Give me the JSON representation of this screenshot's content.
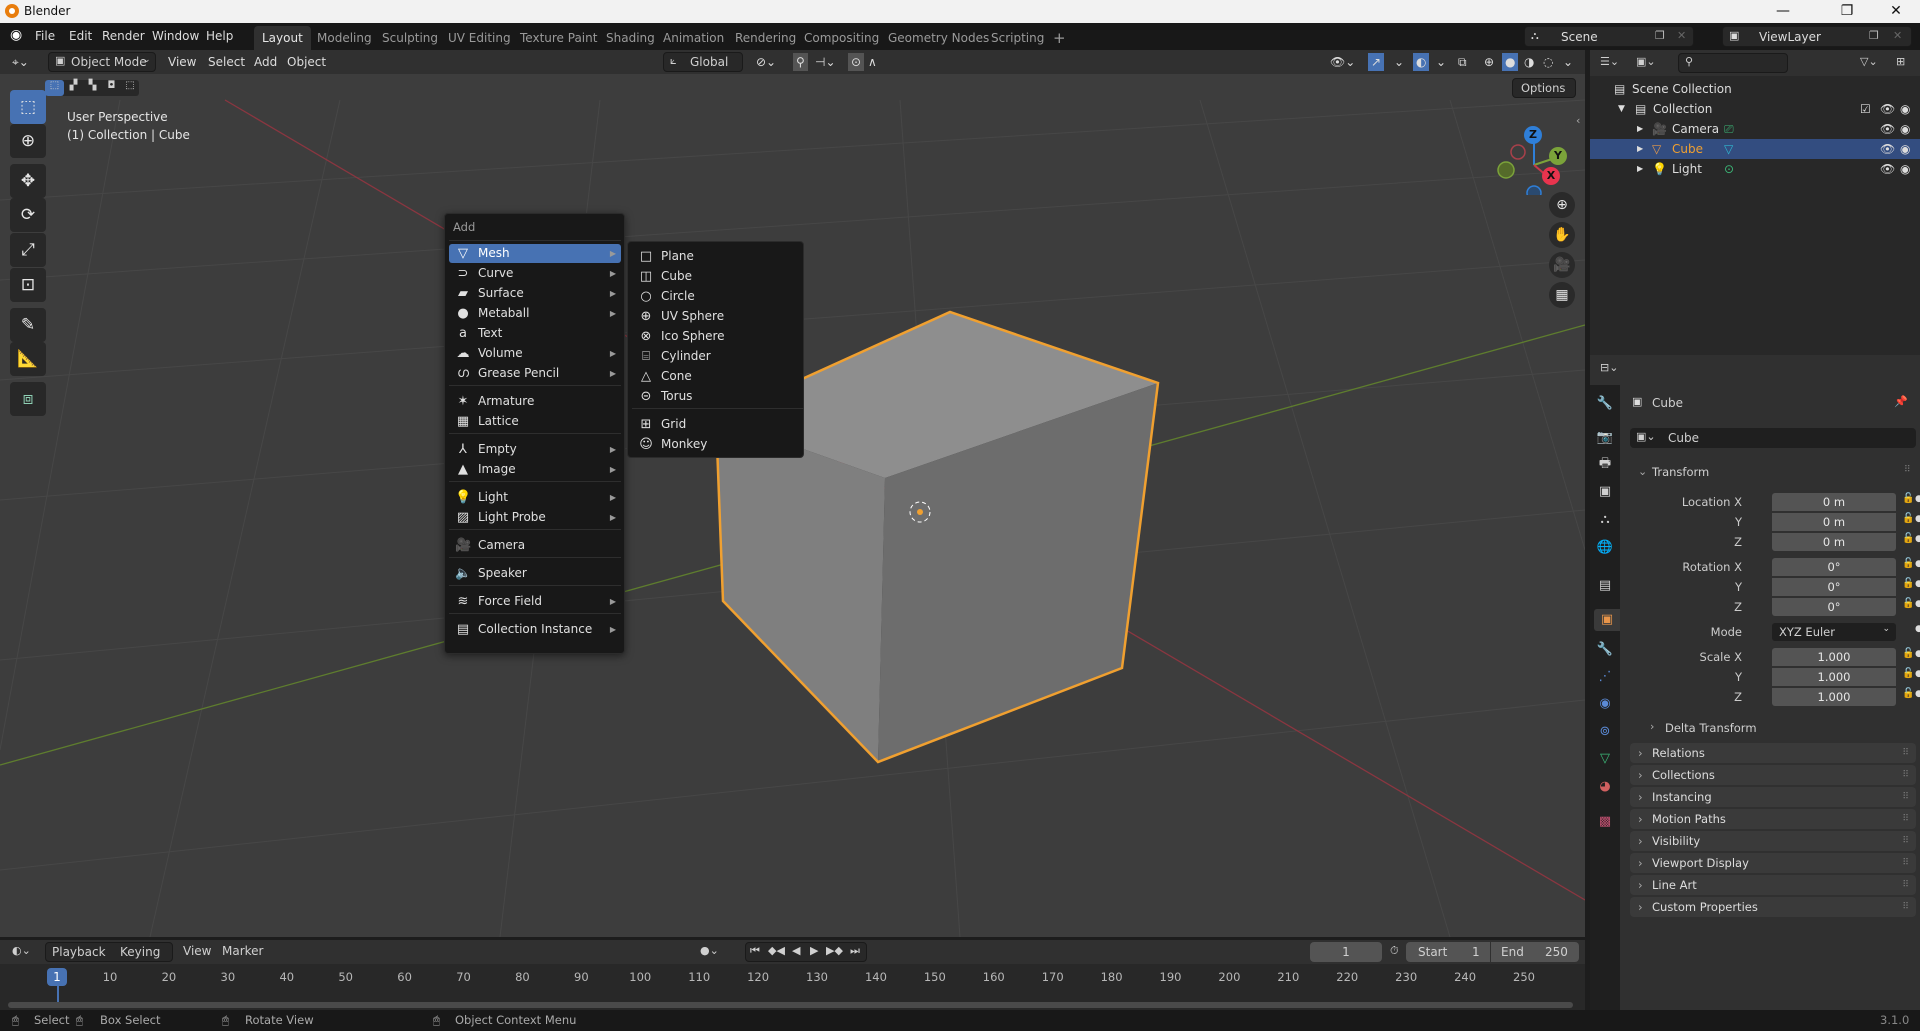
{
  "window": {
    "title": "Blender",
    "minimize": "—",
    "maximize": "❐",
    "close": "✕"
  },
  "menubar": {
    "items": [
      "File",
      "Edit",
      "Render",
      "Window",
      "Help"
    ],
    "workspaces": [
      "Layout",
      "Modeling",
      "Sculpting",
      "UV Editing",
      "Texture Paint",
      "Shading",
      "Animation",
      "Rendering",
      "Compositing",
      "Geometry Nodes",
      "Scripting"
    ],
    "active_workspace": "Layout",
    "add_workspace": "+",
    "scene": "Scene",
    "view_layer": "ViewLayer"
  },
  "viewport_header": {
    "mode": "Object Mode",
    "menus": [
      "View",
      "Select",
      "Add",
      "Object"
    ],
    "orientation": "Global",
    "options": "Options"
  },
  "viewport": {
    "view_name": "User Perspective",
    "context": "(1) Collection | Cube",
    "gizmo_axes": [
      "Z",
      "Y",
      "X"
    ],
    "colors": {
      "x_axis": "#c8384a",
      "y_axis": "#7ba33a",
      "z_axis": "#2f7fd8",
      "selection": "#f0a030",
      "accent": "#4772b3"
    }
  },
  "add_menu": {
    "title": "Add",
    "items": [
      {
        "label": "Mesh",
        "icon": "mesh-icon",
        "glyph": "▽",
        "submenu": true,
        "highlighted": true
      },
      {
        "label": "Curve",
        "icon": "curve-icon",
        "glyph": "⊃",
        "submenu": true
      },
      {
        "label": "Surface",
        "icon": "surface-icon",
        "glyph": "▰",
        "submenu": true
      },
      {
        "label": "Metaball",
        "icon": "metaball-icon",
        "glyph": "●",
        "submenu": true
      },
      {
        "label": "Text",
        "icon": "text-icon",
        "glyph": "a",
        "submenu": false
      },
      {
        "label": "Volume",
        "icon": "volume-icon",
        "glyph": "☁",
        "submenu": true
      },
      {
        "label": "Grease Pencil",
        "icon": "grease-pencil-icon",
        "glyph": "ഗ",
        "submenu": true
      },
      {
        "label": "Armature",
        "icon": "armature-icon",
        "glyph": "✶",
        "submenu": false
      },
      {
        "label": "Lattice",
        "icon": "lattice-icon",
        "glyph": "▦",
        "submenu": false
      },
      {
        "label": "Empty",
        "icon": "empty-icon",
        "glyph": "⅄",
        "submenu": true
      },
      {
        "label": "Image",
        "icon": "image-icon",
        "glyph": "▲",
        "submenu": true
      },
      {
        "label": "Light",
        "icon": "light-icon",
        "glyph": "💡",
        "submenu": true
      },
      {
        "label": "Light Probe",
        "icon": "light-probe-icon",
        "glyph": "▨",
        "submenu": true
      },
      {
        "label": "Camera",
        "icon": "camera-icon",
        "glyph": "🎥",
        "submenu": false
      },
      {
        "label": "Speaker",
        "icon": "speaker-icon",
        "glyph": "🔈",
        "submenu": false
      },
      {
        "label": "Force Field",
        "icon": "force-field-icon",
        "glyph": "≋",
        "submenu": true
      },
      {
        "label": "Collection Instance",
        "icon": "collection-instance-icon",
        "glyph": "▤",
        "submenu": true
      }
    ]
  },
  "mesh_submenu": {
    "items": [
      {
        "label": "Plane",
        "icon": "plane-icon",
        "glyph": "□"
      },
      {
        "label": "Cube",
        "icon": "cube-icon",
        "glyph": "◫"
      },
      {
        "label": "Circle",
        "icon": "circle-icon",
        "glyph": "○"
      },
      {
        "label": "UV Sphere",
        "icon": "uv-sphere-icon",
        "glyph": "⊕"
      },
      {
        "label": "Ico Sphere",
        "icon": "ico-sphere-icon",
        "glyph": "⊗"
      },
      {
        "label": "Cylinder",
        "icon": "cylinder-icon",
        "glyph": "⌸"
      },
      {
        "label": "Cone",
        "icon": "cone-icon",
        "glyph": "△"
      },
      {
        "label": "Torus",
        "icon": "torus-icon",
        "glyph": "⊝"
      },
      {
        "label": "Grid",
        "icon": "grid-icon",
        "glyph": "⊞"
      },
      {
        "label": "Monkey",
        "icon": "monkey-icon",
        "glyph": "☺"
      }
    ]
  },
  "outliner": {
    "root": "Scene Collection",
    "collection": "Collection",
    "objects": [
      {
        "name": "Camera",
        "selected": false,
        "type_glyph": "🎥",
        "data_glyph": "⎚"
      },
      {
        "name": "Cube",
        "selected": true,
        "type_glyph": "▽",
        "data_glyph": "▽"
      },
      {
        "name": "Light",
        "selected": false,
        "type_glyph": "💡",
        "data_glyph": "⊙"
      }
    ]
  },
  "properties": {
    "object_name": "Cube",
    "data_name": "Cube",
    "transform_title": "Transform",
    "location": {
      "label": "Location X",
      "x": "0 m",
      "y": "0 m",
      "z": "0 m"
    },
    "rotation": {
      "label": "Rotation X",
      "x": "0°",
      "y": "0°",
      "z": "0°"
    },
    "mode_label": "Mode",
    "mode": "XYZ Euler",
    "scale": {
      "label": "Scale X",
      "x": "1.000",
      "y": "1.000",
      "z": "1.000"
    },
    "axis_y": "Y",
    "axis_z": "Z",
    "delta_transform": "Delta Transform",
    "panels": [
      "Relations",
      "Collections",
      "Instancing",
      "Motion Paths",
      "Visibility",
      "Viewport Display",
      "Line Art",
      "Custom Properties"
    ]
  },
  "timeline": {
    "menus": [
      "Playback",
      "Keying",
      "View",
      "Marker"
    ],
    "current_frame": "1",
    "start_label": "Start",
    "start": "1",
    "end_label": "End",
    "end": "250",
    "ticks": [
      "10",
      "20",
      "30",
      "40",
      "50",
      "60",
      "70",
      "80",
      "90",
      "100",
      "110",
      "120",
      "130",
      "140",
      "150",
      "160",
      "170",
      "180",
      "190",
      "200",
      "210",
      "220",
      "230",
      "240",
      "250"
    ]
  },
  "statusbar": {
    "select": "Select",
    "box_select": "Box Select",
    "rotate_view": "Rotate View",
    "context_menu": "Object Context Menu",
    "version": "3.1.0"
  }
}
